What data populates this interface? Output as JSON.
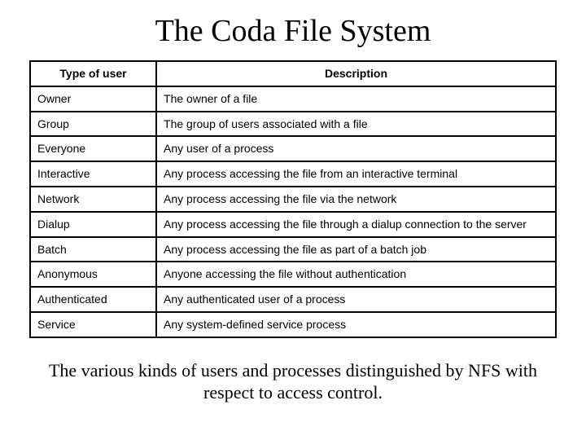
{
  "title": "The Coda File System",
  "headers": {
    "type": "Type of user",
    "desc": "Description"
  },
  "rows": [
    {
      "type": "Owner",
      "desc": "The owner of a file"
    },
    {
      "type": "Group",
      "desc": "The group of users associated with a file"
    },
    {
      "type": "Everyone",
      "desc": "Any user of a process"
    },
    {
      "type": "Interactive",
      "desc": "Any process accessing the file from an interactive terminal"
    },
    {
      "type": "Network",
      "desc": "Any process accessing the file via the network"
    },
    {
      "type": "Dialup",
      "desc": "Any process accessing the file through a dialup connection to the server"
    },
    {
      "type": "Batch",
      "desc": "Any process accessing the file as part of a batch job"
    },
    {
      "type": "Anonymous",
      "desc": "Anyone accessing the file without authentication"
    },
    {
      "type": "Authenticated",
      "desc": "Any authenticated user of a process"
    },
    {
      "type": "Service",
      "desc": "Any system-defined service process"
    }
  ],
  "caption": "The various kinds of users and processes distinguished by NFS with respect to access control."
}
